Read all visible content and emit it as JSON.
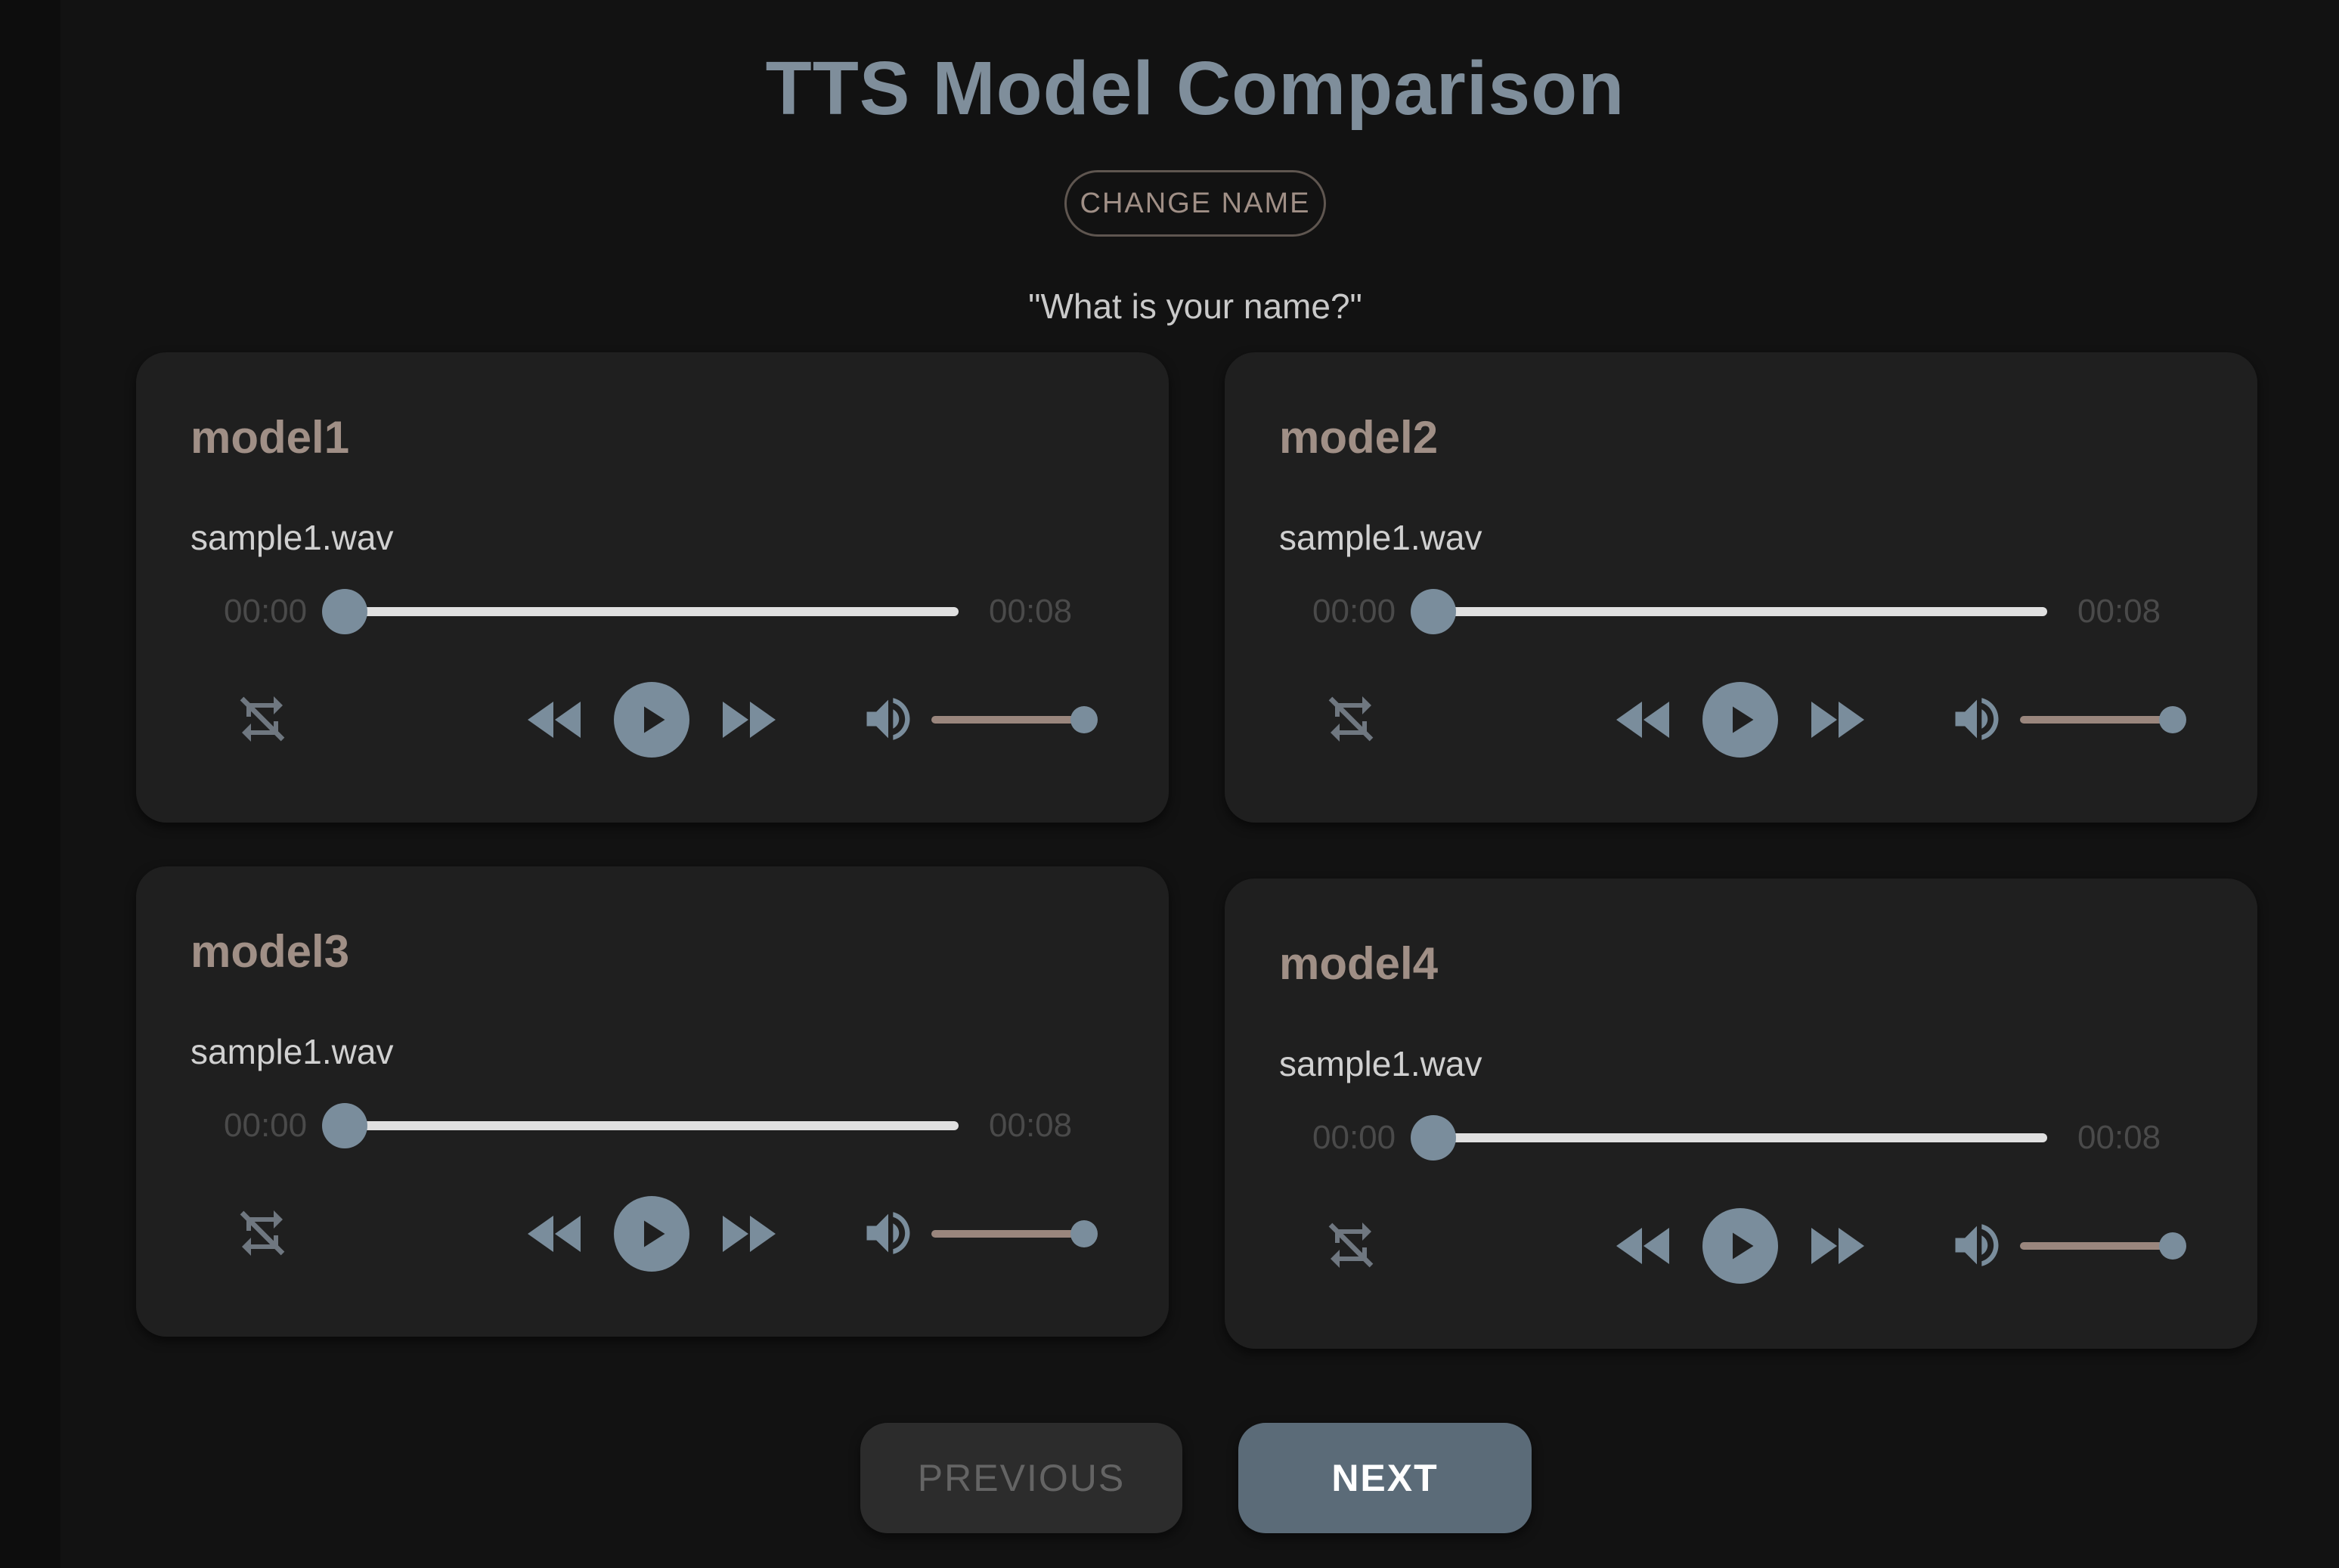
{
  "header": {
    "title": "TTS Model Comparison",
    "change_name_label": "CHANGE NAME",
    "prompt": "\"What is your name?\""
  },
  "colors": {
    "background": "#121212",
    "card": "#1f1f1f",
    "title": "#7f8e9b",
    "accent_taupe": "#a08f86",
    "accent_slate": "#7a8d9c",
    "next_button": "#5b6b78"
  },
  "models": [
    {
      "name": "model1",
      "file": "sample1.wav",
      "current_time": "00:00",
      "duration": "00:08",
      "progress": 0,
      "volume": 1
    },
    {
      "name": "model2",
      "file": "sample1.wav",
      "current_time": "00:00",
      "duration": "00:08",
      "progress": 0,
      "volume": 1
    },
    {
      "name": "model3",
      "file": "sample1.wav",
      "current_time": "00:00",
      "duration": "00:08",
      "progress": 0,
      "volume": 1
    },
    {
      "name": "model4",
      "file": "sample1.wav",
      "current_time": "00:00",
      "duration": "00:08",
      "progress": 0,
      "volume": 1
    }
  ],
  "player_icons": [
    "repeat-off-icon",
    "rewind-icon",
    "play-icon",
    "fast-forward-icon",
    "volume-icon"
  ],
  "nav": {
    "previous_label": "PREVIOUS",
    "next_label": "NEXT"
  }
}
